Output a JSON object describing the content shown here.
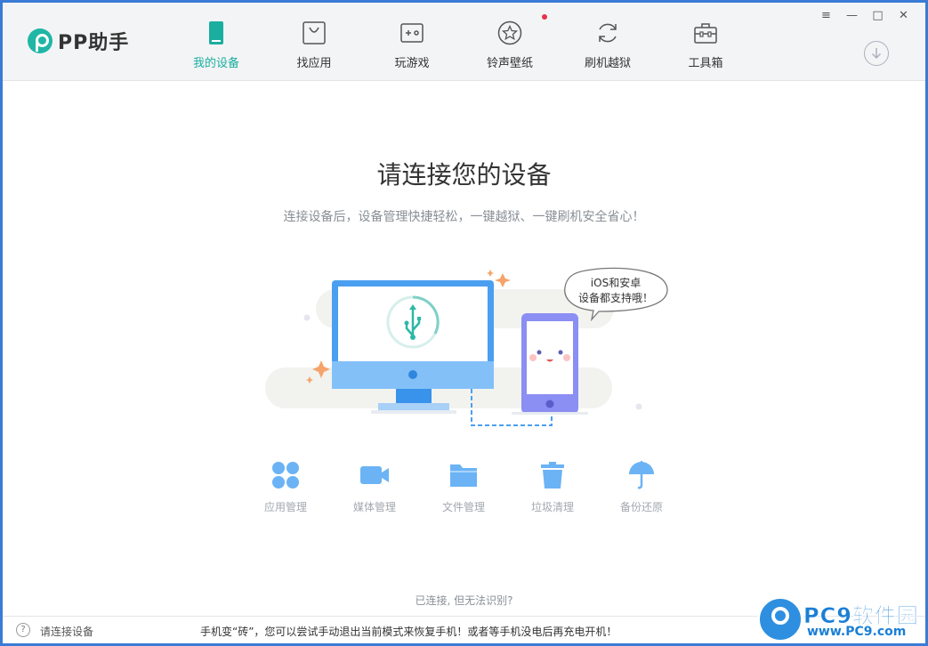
{
  "app": {
    "logo_text": "PP助手",
    "brand_color": "#1aae9f"
  },
  "nav": {
    "items": [
      {
        "label": "我的设备",
        "icon": "device-icon",
        "active": true
      },
      {
        "label": "找应用",
        "icon": "shopping-bag-icon",
        "active": false
      },
      {
        "label": "玩游戏",
        "icon": "gamepad-icon",
        "active": false
      },
      {
        "label": "铃声壁纸",
        "icon": "star-icon",
        "active": false
      },
      {
        "label": "刷机越狱",
        "icon": "refresh-icon",
        "active": false
      },
      {
        "label": "工具箱",
        "icon": "toolbox-icon",
        "active": false,
        "badge": "red-dot"
      }
    ]
  },
  "window_controls": {
    "menu": "≡",
    "minimize": "—",
    "maximize": "□",
    "close": "✕"
  },
  "main": {
    "title": "请连接您的设备",
    "subtitle": "连接设备后，设备管理快捷轻松，一键越狱、一键刷机安全省心！",
    "bubble_line1": "iOS和安卓",
    "bubble_line2": "设备都支持哦！",
    "features": [
      {
        "label": "应用管理",
        "icon": "apps-icon"
      },
      {
        "label": "媒体管理",
        "icon": "video-camera-icon"
      },
      {
        "label": "文件管理",
        "icon": "folder-icon"
      },
      {
        "label": "垃圾清理",
        "icon": "trash-icon"
      },
      {
        "label": "备份还原",
        "icon": "umbrella-icon"
      }
    ],
    "cant_detect": "已连接, 但无法识别?"
  },
  "statusbar": {
    "help": "?",
    "status": "请连接设备",
    "tip": "手机变“砖”，您可以尝试手动退出当前模式来恢复手机！或者等手机没电后再充电开机！"
  },
  "watermark": {
    "title": "PC9软件园",
    "url": "www.PC9.com"
  }
}
